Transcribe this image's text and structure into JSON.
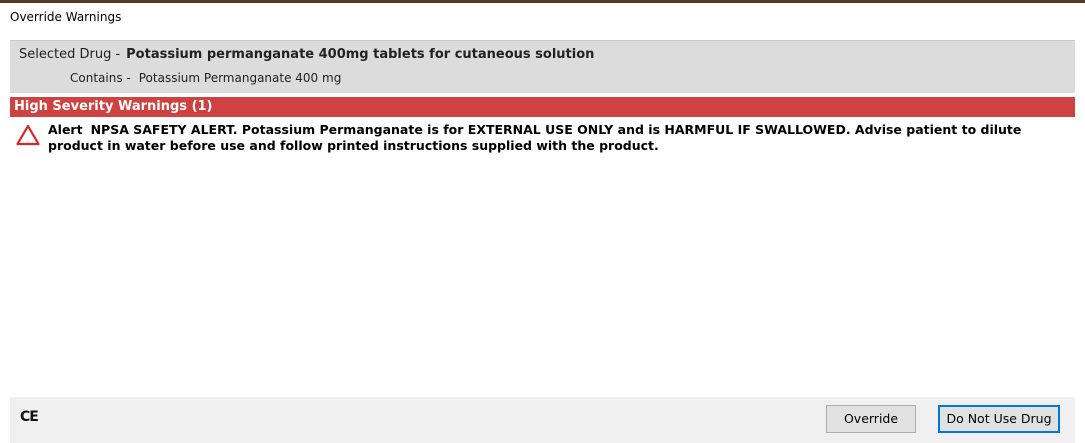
{
  "window": {
    "title": "Override Warnings"
  },
  "drug": {
    "selected_label": "Selected Drug -",
    "selected_value": "Potassium permanganate 400mg tablets for cutaneous solution",
    "contains_label": "Contains -",
    "contains_value": "Potassium Permanganate 400 mg"
  },
  "warnings": {
    "header": "High Severity Warnings (1)",
    "items": [
      {
        "label": "Alert",
        "text": "NPSA SAFETY ALERT. Potassium Permanganate is for EXTERNAL USE ONLY and is HARMFUL IF SWALLOWED. Advise patient to dilute product in water before use and follow printed instructions supplied with the product.",
        "icon": "warning-triangle-icon"
      }
    ]
  },
  "footer": {
    "ce_mark": "CE",
    "override_label": "Override",
    "do_not_use_label": "Do Not Use Drug"
  },
  "colors": {
    "severity_bar": "#cf4242",
    "header_bg": "#dcdcdc",
    "footer_bg": "#f0f0f0",
    "default_button_border": "#0078d7",
    "warning_icon": "#d9262b"
  }
}
